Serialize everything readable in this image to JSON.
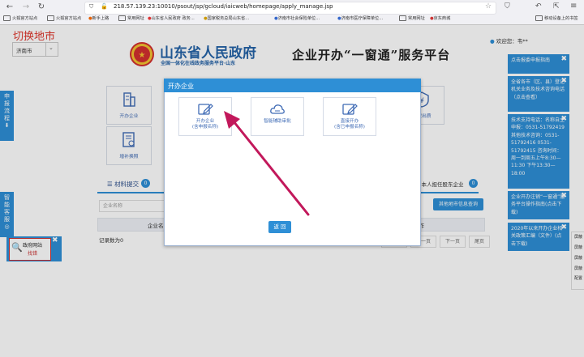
{
  "browser": {
    "url": "218.57.139.23:10010/psout/jsp/gcloud/iaicweb/homepage/apply_manage.jsp",
    "bookmarks": [
      "火狐官方站点",
      "火狐官方站点",
      "新手上路",
      "常用网址",
      "山东省人民政府 政务...",
      "国家税务总局山东省...",
      "济南市社会保险单位...",
      "济南市医疗保障单位...",
      "常用网址",
      "京东商城"
    ],
    "mobile_bookmarks": "移动设备上的书签"
  },
  "page": {
    "city_title": "切换地市",
    "city_value": "济南市",
    "gov_name": "山东省人民政府",
    "gov_sub": "全国一体化在线政务服务平台·山东",
    "platform_title": "企业开办“一窗通”服务平台",
    "welcome": "欢迎您：韦**"
  },
  "services": [
    {
      "label": "开办企业",
      "icon": "building-icon"
    },
    {
      "label": "股权出质",
      "icon": "equity-icon"
    },
    {
      "label": "增补换照",
      "icon": "license-icon"
    }
  ],
  "side_tabs": {
    "flow": "申报流程",
    "assistant": "智能客服"
  },
  "lower": {
    "materials_tab": "材料提交",
    "materials_count": "0",
    "other_count": "0",
    "legal_label": "本人担任股东企业",
    "legal_count": "0",
    "enterprise_placeholder": "企业名称",
    "other_city_button": "其他地市信息查询",
    "col_enterprise": "企业名",
    "col_operation": "操作",
    "records": "记录数为0",
    "pager": [
      "首页",
      "上一页",
      "下一页",
      "尾页"
    ]
  },
  "error_widget": {
    "line1": "政府网站",
    "line2": "找错"
  },
  "right_panel": [
    "点击报委申报指南",
    "全省各市（区、县）登记机关业务及技术咨询电话（点击查看）",
    "技术支持电话：名称自主申报：0531-51792419 其他技术咨询：0531-51792416 0531-51792415 咨询时间：周一到周五上午8:30—11:30 下午13:30—18:00",
    "企业开办注销“一窗通”服务平台操作指南(点击下载)",
    "2020年以来开办企业相关政策汇编（文件）(点击下载)"
  ],
  "edge_menu": [
    "屏蔽",
    "屏蔽",
    "屏蔽",
    "屏蔽",
    "配置"
  ],
  "modal": {
    "title": "开办企业",
    "options": [
      {
        "line1": "开办企业",
        "line2": "(含申报名称)",
        "icon": "edit-form-icon"
      },
      {
        "line1": "智能辅助审批",
        "line2": "",
        "icon": "cloud-icon"
      },
      {
        "line1": "直接开办",
        "line2": "(含已申报名称)",
        "icon": "edit-form-icon"
      }
    ],
    "back_button": "返 回"
  },
  "colors": {
    "primary": "#2e8fd6",
    "title_red": "#e0352b",
    "arrow": "#c2185b"
  }
}
